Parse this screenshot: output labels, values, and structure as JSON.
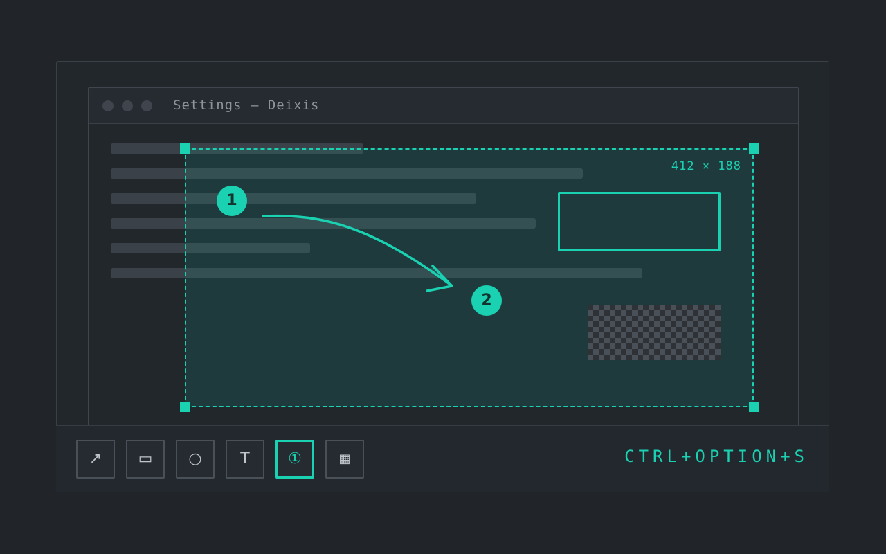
{
  "window": {
    "title": "Settings — Deixis"
  },
  "selection": {
    "size_readout": "412 × 188"
  },
  "annotations": {
    "step_1": "1",
    "step_2": "2"
  },
  "toolbar": {
    "tools": [
      {
        "name": "arrow",
        "glyph": "↗",
        "active": false
      },
      {
        "name": "rectangle",
        "glyph": "▭",
        "active": false
      },
      {
        "name": "ellipse",
        "glyph": "○",
        "active": false
      },
      {
        "name": "text",
        "glyph": "T",
        "active": false
      },
      {
        "name": "step",
        "glyph": "①",
        "active": true
      },
      {
        "name": "pixelate",
        "glyph": "▦",
        "active": false
      }
    ],
    "shortcut": "CTRL+OPTION+S"
  },
  "colors": {
    "accent": "#1ad1b2",
    "background": "#212529"
  }
}
